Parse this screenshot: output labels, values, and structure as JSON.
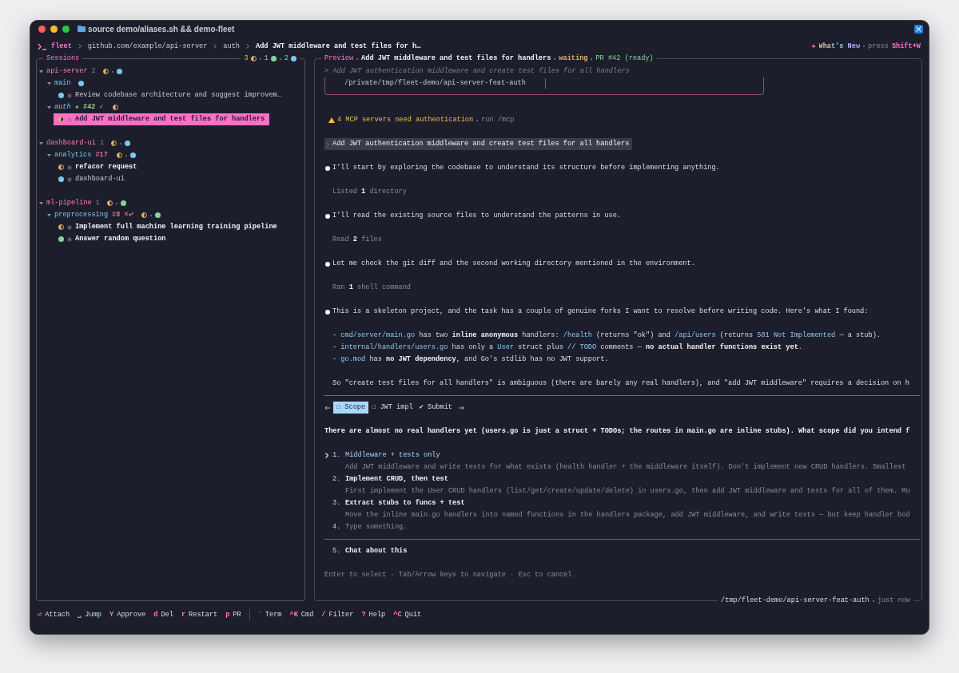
{
  "window": {
    "title": "source demo/aliases.sh && demo-fleet"
  },
  "header": {
    "app": "fleet",
    "breadcrumb": [
      "github.com/example/api-server",
      "auth",
      "Add JWT middleware and test files for h…"
    ],
    "whats_new": {
      "label": "What's New",
      "hint": "press",
      "key": "Shift+W"
    }
  },
  "sessions": {
    "title": "Sessions",
    "summary": [
      {
        "count": "3",
        "kind": "half",
        "color": "#e2b56c"
      },
      {
        "count": "1",
        "kind": "dot",
        "color": "#86d39b"
      },
      {
        "count": "2",
        "kind": "dot",
        "color": "#7cc6ee"
      }
    ],
    "repos": [
      {
        "name": "api-server",
        "count": "2",
        "expanded": true,
        "statuses": [
          {
            "kind": "half",
            "color": "#e2b56c"
          },
          {
            "kind": "dot",
            "color": "#7cc6ee"
          }
        ],
        "branches": [
          {
            "name": "main",
            "current": false,
            "expanded": true,
            "statuses": [
              {
                "kind": "dot",
                "color": "#7cc6ee"
              }
            ],
            "items": [
              {
                "title": "Review codebase architecture and suggest improvem…",
                "status": {
                  "kind": "dot",
                  "color": "#7cc6ee"
                },
                "unread": false,
                "selected": false
              }
            ]
          },
          {
            "name": "auth",
            "current": true,
            "expanded": true,
            "badges": [
              {
                "text": "★ #42 ✓",
                "color": "#8fcf8a"
              }
            ],
            "statuses": [
              {
                "kind": "half",
                "color": "#e2b56c"
              }
            ],
            "items": [
              {
                "title": "Add JWT middleware and test files for handlers",
                "status": {
                  "kind": "half",
                  "color": "#e2b56c"
                },
                "unread": true,
                "selected": true
              }
            ]
          }
        ]
      },
      {
        "name": "dashboard-ui",
        "count": "1",
        "expanded": true,
        "statuses": [
          {
            "kind": "half",
            "color": "#e2b56c"
          },
          {
            "kind": "dot",
            "color": "#7cc6ee"
          }
        ],
        "branches": [
          {
            "name": "analytics",
            "current": false,
            "expanded": true,
            "badges": [
              {
                "text": "#17",
                "color": "#e0708f"
              }
            ],
            "statuses": [
              {
                "kind": "half",
                "color": "#e2b56c"
              },
              {
                "kind": "dot",
                "color": "#7cc6ee"
              }
            ],
            "items": [
              {
                "title": "refacor request",
                "status": {
                  "kind": "half",
                  "color": "#e2b56c"
                },
                "unread": true,
                "selected": false
              },
              {
                "title": "dashboard-ui",
                "status": {
                  "kind": "dot",
                  "color": "#7cc6ee"
                },
                "unread": false,
                "selected": false
              }
            ]
          }
        ]
      },
      {
        "name": "ml-pipeline",
        "count": "1",
        "expanded": true,
        "statuses": [
          {
            "kind": "half",
            "color": "#e2b56c"
          },
          {
            "kind": "dot",
            "color": "#86d39b"
          }
        ],
        "branches": [
          {
            "name": "preprocessing",
            "current": false,
            "expanded": true,
            "badges": [
              {
                "text": "#8 ×⤶",
                "color": "#e06a78"
              }
            ],
            "statuses": [
              {
                "kind": "half",
                "color": "#e2b56c"
              },
              {
                "kind": "dot",
                "color": "#86d39b"
              }
            ],
            "items": [
              {
                "title": "Implement full machine learning training pipeline",
                "status": {
                  "kind": "half",
                  "color": "#e2b56c"
                },
                "unread": true,
                "selected": false
              },
              {
                "title": "Answer random question",
                "status": {
                  "kind": "dot",
                  "color": "#86d39b"
                },
                "unread": true,
                "selected": false
              }
            ]
          }
        ]
      }
    ]
  },
  "preview": {
    "title": "Preview",
    "session": "Add JWT middleware and test files for handlers",
    "state": "waiting",
    "pr": "PR #42 (ready)",
    "transcript": [
      {
        "kind": "prompt_echo",
        "text": "> Add JWT authentication middleware and create test files for all handlers"
      },
      {
        "kind": "path_box",
        "text": "/private/tmp/fleet-demo/api-server-feat-auth"
      },
      {
        "kind": "warning",
        "text": "4 MCP servers need authentication",
        "hint": "run /mcp"
      },
      {
        "kind": "user",
        "text": "Add JWT authentication middleware and create test files for all handlers"
      },
      {
        "kind": "assistant",
        "text": "I'll start by exploring the codebase to understand its structure before implementing anything."
      },
      {
        "kind": "tool",
        "text": "Listed **1** directory"
      },
      {
        "kind": "assistant",
        "text": "I'll read the existing source files to understand the patterns in use."
      },
      {
        "kind": "tool",
        "text": "Read **2** files"
      },
      {
        "kind": "assistant",
        "text": "Let me check the git diff and the second working directory mentioned in the environment."
      },
      {
        "kind": "tool",
        "text": "Ran **1** shell command"
      },
      {
        "kind": "assistant",
        "text": "This is a skeleton project, and the task has a couple of genuine forks I want to resolve before writing code. Here's what I found:"
      },
      {
        "kind": "list",
        "lines": [
          [
            {
              "text": "- "
            },
            {
              "text": "cmd/server/main.go",
              "kind": "code"
            },
            {
              "text": " has two "
            },
            {
              "text": "inline anonymous",
              "kind": "bold"
            },
            {
              "text": " handlers: "
            },
            {
              "text": "/health",
              "kind": "code"
            },
            {
              "text": " (returns \"ok\") and "
            },
            {
              "text": "/api/users",
              "kind": "code"
            },
            {
              "text": " (returns "
            },
            {
              "text": "501 Not Implemented",
              "kind": "code"
            },
            {
              "text": " — a stub)."
            }
          ],
          [
            {
              "text": "- "
            },
            {
              "text": "internal/handlers/users.go",
              "kind": "code"
            },
            {
              "text": " has only a "
            },
            {
              "text": "User",
              "kind": "code"
            },
            {
              "text": " struct plus "
            },
            {
              "text": "// TODO",
              "kind": "code"
            },
            {
              "text": " comments — "
            },
            {
              "text": "no actual handler functions exist yet",
              "kind": "bold"
            },
            {
              "text": "."
            }
          ],
          [
            {
              "text": "- "
            },
            {
              "text": "go.mod",
              "kind": "code"
            },
            {
              "text": " has "
            },
            {
              "text": "no JWT dependency",
              "kind": "bold"
            },
            {
              "text": ", and Go's stdlib has no JWT support."
            }
          ]
        ]
      },
      {
        "kind": "paragraph",
        "text": "So \"create test files for all handlers\" is ambiguous (there are barely any real handlers), and \"add JWT middleware\" requires a decision on h"
      }
    ],
    "question": {
      "tabs": [
        {
          "label": "☐ Scope",
          "selected": true
        },
        {
          "label": "☐ JWT impl",
          "selected": false
        },
        {
          "label": "✔ Submit",
          "selected": false
        }
      ],
      "prompt": "There are almost no real handlers yet (users.go is just a struct + TODOs; the routes in main.go are inline stubs). What scope did you intend f",
      "options": [
        {
          "kind": "choice",
          "number": "1.",
          "title": "Middleware + tests only",
          "description": "Add JWT middleware and write tests for what exists (health handler + the middleware itself). Don't implement new CRUD handlers. Smallest",
          "selected": true
        },
        {
          "kind": "choice",
          "number": "2.",
          "title": "Implement CRUD, then test",
          "description": "First implement the User CRUD handlers (list/get/create/update/delete) in users.go, then add JWT middleware and tests for all of them. Mu",
          "selected": false
        },
        {
          "kind": "choice",
          "number": "3.",
          "title": "Extract stubs to funcs + test",
          "description": "Move the inline main.go handlers into named functions in the handlers package, add JWT middleware, and write tests — but keep handler bod",
          "selected": false
        },
        {
          "kind": "freeform",
          "number": "4.",
          "title": "Type something.",
          "selected": false
        }
      ],
      "chat_option": {
        "number": "5.",
        "title": "Chat about this"
      },
      "hint": "Enter to select · Tab/Arrow keys to navigate · Esc to cancel"
    },
    "location": "/tmp/fleet-demo/api-server-feat-auth",
    "updated": "just now"
  },
  "footer": [
    [
      {
        "key": "⏎",
        "label": "Attach"
      },
      {
        "key": "␣",
        "label": "Jump"
      },
      {
        "key": "Y",
        "label": "Approve"
      },
      {
        "key": "d",
        "label": "Del"
      },
      {
        "key": "r",
        "label": "Restart"
      },
      {
        "key": "p",
        "label": "PR"
      }
    ],
    [
      {
        "key": "`",
        "label": "Term"
      },
      {
        "key": "^K",
        "label": "Cmd"
      },
      {
        "key": "/",
        "label": "Filter"
      },
      {
        "key": "?",
        "label": "Help"
      },
      {
        "key": "^C",
        "label": "Quit"
      }
    ]
  ]
}
